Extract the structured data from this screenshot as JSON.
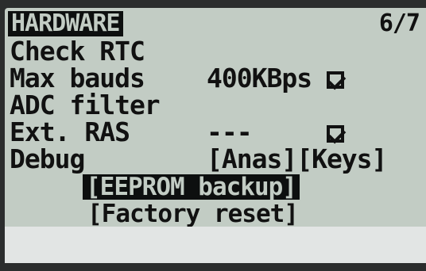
{
  "header": {
    "title": "HARDWARE",
    "page": "6/7"
  },
  "settings": [
    {
      "label": "Check RTC",
      "value": "",
      "checked": true,
      "type": "checkbox"
    },
    {
      "label": "Max bauds",
      "value": "400KBps",
      "type": "text"
    },
    {
      "label": "ADC filter",
      "value": "",
      "checked": true,
      "type": "checkbox"
    },
    {
      "label": "Ext. RAS",
      "value": "---",
      "type": "text"
    },
    {
      "label": "Debug",
      "value": "[Anas][Keys]",
      "type": "text"
    }
  ],
  "actions": {
    "eeprom_backup": "[EEPROM backup]",
    "factory_reset": "[Factory reset]"
  },
  "icons": {
    "checkbox": "checked-checkbox-icon"
  },
  "colors": {
    "lcd_background": "#c2ccc4",
    "lcd_lower": "#e2e5e4",
    "pixel_dark": "#0d0f0f",
    "bezel": "#2b2d2d"
  }
}
